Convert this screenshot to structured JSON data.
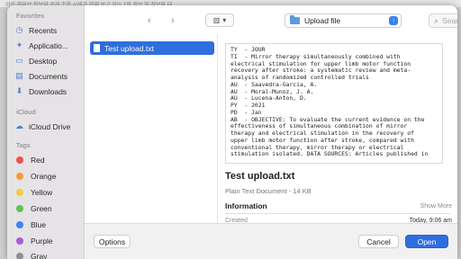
{
  "background": {
    "strip_text": "이의 하이브 정보의 공개 조회 시세가 현재 보고 있는 1장 정보 및 정보와 대"
  },
  "sidebar": {
    "favorites_header": "Favorites",
    "favorites": [
      {
        "label": "Recents",
        "icon": "clock-icon"
      },
      {
        "label": "Applicatio...",
        "icon": "apps-icon"
      },
      {
        "label": "Desktop",
        "icon": "desktop-icon"
      },
      {
        "label": "Documents",
        "icon": "document-icon"
      },
      {
        "label": "Downloads",
        "icon": "download-icon"
      }
    ],
    "icloud_header": "iCloud",
    "icloud": [
      {
        "label": "iCloud Drive",
        "icon": "cloud-icon"
      }
    ],
    "tags_header": "Tags",
    "tags": [
      {
        "label": "Red",
        "color": "#f0514b"
      },
      {
        "label": "Orange",
        "color": "#f59a33"
      },
      {
        "label": "Yellow",
        "color": "#f7cc3b"
      },
      {
        "label": "Green",
        "color": "#5fc350"
      },
      {
        "label": "Blue",
        "color": "#3b82f6"
      },
      {
        "label": "Purple",
        "color": "#a55ed1"
      },
      {
        "label": "Gray",
        "color": "#8e8e93"
      }
    ]
  },
  "toolbar": {
    "back_icon": "chevron-left-icon",
    "forward_icon": "chevron-right-icon",
    "view_icon": "column-view-icon",
    "location": "Upload file",
    "search_placeholder": "Search"
  },
  "filelist": {
    "files": [
      {
        "name": "Test upload.txt",
        "selected": true
      }
    ]
  },
  "preview": {
    "content_lines": [
      "TY  - JOUR",
      "TI  - Mirror therapy simultaneously combined with",
      "electrical stimulation for upper limb motor function",
      "recovery after stroke: a systematic review and meta-",
      "analysis of randomized controlled trials",
      "AU  - Saavedra-Garcia, A.",
      "AU  - Moral-Munoz, J. A.",
      "AU  - Lucena-Anton, D.",
      "PY  - 2021",
      "PD  - Jan",
      "AB  - OBJECTIVE: To evaluate the current evidence on the",
      "effectiveness of simultaneous combination of mirror",
      "therapy and electrical stimulation in the recovery of",
      "upper limb motor function after stroke, compared with",
      "conventional therapy, mirror therapy or electrical",
      "stimulation isolated. DATA SOURCES: Articles published in"
    ],
    "file_name": "Test upload.txt",
    "file_kind": "Plain Text Document - 14 KB",
    "info_label": "Information",
    "show_more": "Show More",
    "created_label": "Created",
    "created_value": "Today, 9:06 am"
  },
  "buttons": {
    "options": "Options",
    "cancel": "Cancel",
    "open": "Open"
  }
}
